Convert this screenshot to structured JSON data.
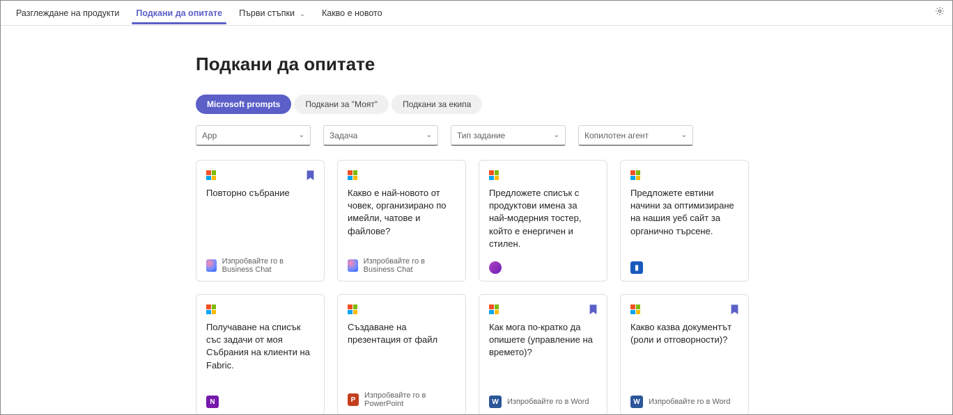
{
  "nav": {
    "items": [
      {
        "label": "Разглеждане на продукти",
        "active": false,
        "hasDropdown": false
      },
      {
        "label": "Подкани да опитате",
        "active": true,
        "hasDropdown": false
      },
      {
        "label": "Първи стъпки",
        "active": false,
        "hasDropdown": true
      },
      {
        "label": "Какво е новото",
        "active": false,
        "hasDropdown": false
      }
    ]
  },
  "page": {
    "title": "Подкани да опитате"
  },
  "tabs": {
    "items": [
      {
        "label": "Microsoft prompts",
        "active": true
      },
      {
        "label": "Подкани за \"Моят\"",
        "active": false
      },
      {
        "label": "Подкани за екипа",
        "active": false
      }
    ]
  },
  "filters": [
    {
      "label": "App"
    },
    {
      "label": "Задача"
    },
    {
      "label": "Тип задание"
    },
    {
      "label": "Копилотен агент"
    }
  ],
  "cards": [
    {
      "title": "Повторно събрание",
      "bookmarked": true,
      "app": "copilot",
      "footer": "Изпробвайте го в Business Chat"
    },
    {
      "title": "Какво е най-новото от човек, организирано по имейли, чатове и файлове?",
      "bookmarked": false,
      "app": "copilot",
      "footer": "Изпробвайте го в Business Chat"
    },
    {
      "title": "Предложете списък с продуктови имена за най-модерния тостер, който е енергичен и стилен.",
      "bookmarked": false,
      "app": "loop",
      "footer": ""
    },
    {
      "title": "Предложете евтини начини за оптимизиране на нашия уеб сайт за органично търсене.",
      "bookmarked": false,
      "app": "clipchamp",
      "footer": ""
    },
    {
      "title": "Получаване на списък със задачи от моя Събрания на клиенти на Fabric.",
      "bookmarked": false,
      "app": "onenote",
      "footer": ""
    },
    {
      "title": "Създаване на презентация от файл",
      "bookmarked": false,
      "app": "powerpoint",
      "footer": "Изпробвайте го в PowerPoint"
    },
    {
      "title": "Как мога по-кратко да опишете (управление на времето)?",
      "bookmarked": true,
      "app": "word",
      "footer": "Изпробвайте го в Word"
    },
    {
      "title": "Какво казва документът (роли и отговорности)?",
      "bookmarked": true,
      "app": "word",
      "footer": "Изпробвайте го в Word"
    }
  ]
}
